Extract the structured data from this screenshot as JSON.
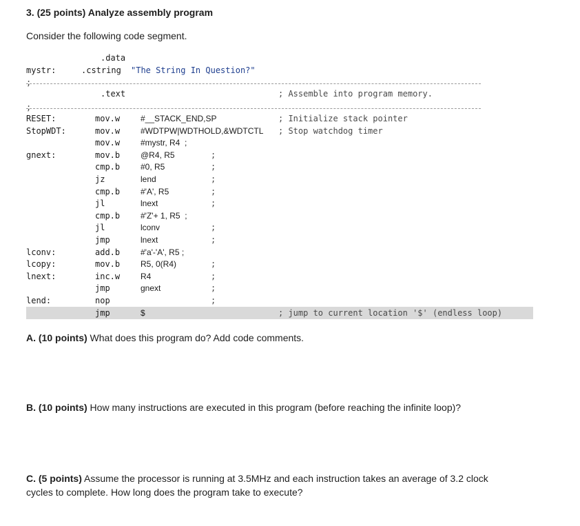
{
  "question": {
    "heading_bold": "3. (25 points) Analyze assembly program",
    "intro": "Consider the following code segment."
  },
  "code": {
    "data_directive": ".data",
    "mystr_label": "mystr:",
    "cstring_directive": ".cstring",
    "cstring_value": "\"The String In Question?\"",
    "sep1": ";",
    "text_directive": ".text",
    "text_comment": "; Assemble into program memory.",
    "sep2": ";",
    "lines": [
      {
        "label": "RESET:",
        "op": "mov.w",
        "arg": "#__STACK_END,SP",
        "comment": "; Initialize stack pointer"
      },
      {
        "label": "StopWDT:",
        "op": "mov.w",
        "arg": "#WDTPW|WDTHOLD,&WDTCTL",
        "comment": "; Stop watchdog timer"
      },
      {
        "label": "",
        "op": "mov.w",
        "arg": "#mystr, R4  ;",
        "comment": ""
      },
      {
        "label": "gnext:",
        "op": "mov.b",
        "arg": "@R4, R5",
        "comment": ";"
      },
      {
        "label": "",
        "op": "cmp.b",
        "arg": "#0, R5",
        "comment": ";"
      },
      {
        "label": "",
        "op": "jz",
        "arg": "lend",
        "comment": ";"
      },
      {
        "label": "",
        "op": "cmp.b",
        "arg": "#'A', R5",
        "comment": ";"
      },
      {
        "label": "",
        "op": "jl",
        "arg": "lnext",
        "comment": ";"
      },
      {
        "label": "",
        "op": "cmp.b",
        "arg": "#'Z'+ 1, R5  ;",
        "comment": ""
      },
      {
        "label": "",
        "op": "jl",
        "arg": "lconv",
        "comment": ";"
      },
      {
        "label": "",
        "op": "jmp",
        "arg": "lnext",
        "comment": ";"
      },
      {
        "label": "lconv:",
        "op": "add.b",
        "arg": "#'a'-'A', R5 ;",
        "comment": ""
      },
      {
        "label": "lcopy:",
        "op": "mov.b",
        "arg": "R5, 0(R4)",
        "comment": ";"
      },
      {
        "label": "lnext:",
        "op": "inc.w",
        "arg": "R4",
        "comment": ";"
      },
      {
        "label": "",
        "op": "jmp",
        "arg": "gnext",
        "comment": ";"
      },
      {
        "label": "lend:",
        "op": "nop",
        "arg": "",
        "comment": ";"
      },
      {
        "label": "",
        "op": "jmp",
        "arg": "$",
        "comment": "; jump to current location '$' (endless loop)"
      }
    ]
  },
  "parts": {
    "a_bold": "A. (10 points)",
    "a_text": " What does this program do? Add code comments.",
    "b_bold": "B. (10 points)",
    "b_text": " How many instructions are executed in this program (before reaching the infinite loop)?",
    "c_bold": "C. (5 points)",
    "c_text_line1": " Assume the processor is running at 3.5MHz and each instruction takes an average of 3.2 clock",
    "c_text_line2": "cycles to complete. How long does the program take to execute?"
  }
}
